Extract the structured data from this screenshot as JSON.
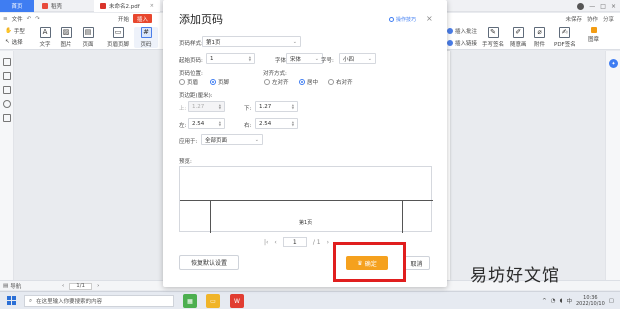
{
  "titlebar": {
    "tabs": [
      {
        "label": "首页"
      },
      {
        "label": "稻壳"
      },
      {
        "label": "未命名2.pdf"
      }
    ],
    "close": "×",
    "right": {
      "minimize": "—",
      "maximize": "□",
      "close": "×"
    }
  },
  "menu": {
    "file": "文件",
    "items": [
      "开始",
      "插入"
    ],
    "right": [
      "未保存",
      "协作",
      "分享"
    ]
  },
  "ribbon": {
    "small": [
      "手型",
      "选择"
    ],
    "buttons": [
      {
        "label": "文字",
        "glyph": "A"
      },
      {
        "label": "图片",
        "glyph": "▨"
      },
      {
        "label": "页面",
        "glyph": "▤"
      },
      {
        "label": "页眉页脚",
        "glyph": "▭"
      },
      {
        "label": "页码",
        "glyph": "#"
      }
    ],
    "right_top": [
      "插入批注",
      "插入链接"
    ],
    "right_bottom": [
      "手写签名",
      "随意画",
      "附件",
      "PDF签名",
      "图章"
    ]
  },
  "dialog": {
    "title": "添加页码",
    "tip": "操作技巧",
    "close": "×",
    "style_label": "页码样式:",
    "style_value": "第1页",
    "start_label": "起始页码:",
    "start_value": "1",
    "font_label": "字体:",
    "font_value": "宋体",
    "size_label": "字号:",
    "size_value": "小四",
    "position_label": "页码位置:",
    "position_header": "页眉",
    "position_footer": "页脚",
    "align_label": "对齐方式:",
    "align_left": "左对齐",
    "align_center": "居中",
    "align_right": "右对齐",
    "margin_label": "页边距(厘米):",
    "top_label": "上:",
    "top_value": "1.27",
    "bottom_label": "下:",
    "bottom_value": "1.27",
    "left_label": "左:",
    "left_value": "2.54",
    "right_label": "右:",
    "right_value": "2.54",
    "apply_label": "应用于:",
    "apply_value": "全部页面",
    "preview_label": "预览:",
    "preview_text": "第1页",
    "pager_current": "1",
    "pager_total": "/ 1",
    "reset_button": "恢复默认设置",
    "ok_button": "确定",
    "cancel_button": "取消"
  },
  "statusbar": {
    "nav": "导航",
    "page": "1/1"
  },
  "taskbar": {
    "search_placeholder": "在这里输入你要搜索的内容",
    "time": "10:36",
    "date": "2022/10/10",
    "lang": "中"
  },
  "watermark": "易坊好文馆",
  "colors": {
    "accent": "#3f7df2",
    "ok": "#f5a11e",
    "highlight": "#e01e1e",
    "insert_tab": "#e8472e"
  }
}
